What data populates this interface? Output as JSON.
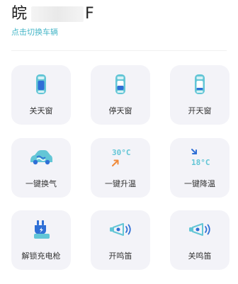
{
  "header": {
    "plate_prefix": "皖",
    "plate_suffix": "F",
    "switch_vehicle_label": "点击切换车辆"
  },
  "controls": [
    {
      "label": "关天窗",
      "icon": "car-sunroof-closed-icon"
    },
    {
      "label": "停天窗",
      "icon": "car-sunroof-stop-icon"
    },
    {
      "label": "开天窗",
      "icon": "car-sunroof-open-icon"
    },
    {
      "label": "一键换气",
      "icon": "car-ventilation-icon"
    },
    {
      "label": "一键升温",
      "icon": "temperature-up-icon",
      "temp": "30°C"
    },
    {
      "label": "一键降温",
      "icon": "temperature-down-icon",
      "temp": "18°C"
    },
    {
      "label": "解锁充电枪",
      "icon": "charging-gun-unlock-icon"
    },
    {
      "label": "开鸣笛",
      "icon": "horn-on-icon"
    },
    {
      "label": "关鸣笛",
      "icon": "horn-off-icon"
    }
  ],
  "colors": {
    "accent": "#48b7c8",
    "orange": "#f08a3a",
    "blue": "#2f6fd6",
    "card_bg": "#f3f3f8"
  }
}
